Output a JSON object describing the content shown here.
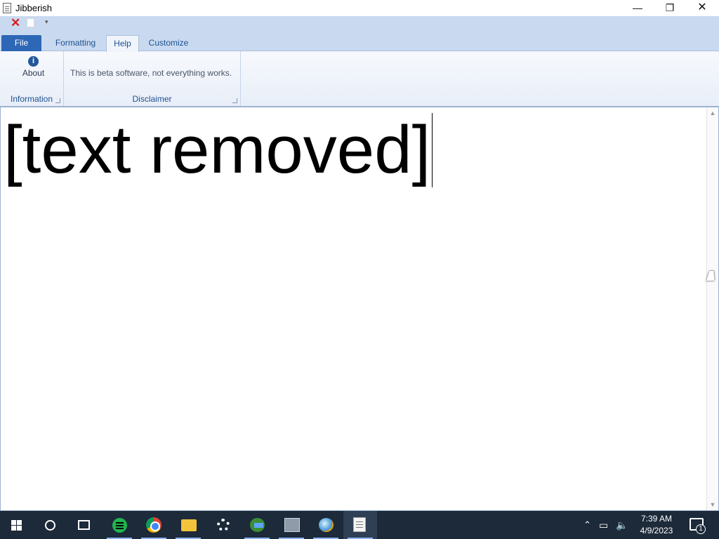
{
  "window": {
    "title": "Jibberish"
  },
  "title_controls": {
    "minimize": "—",
    "maximize": "❐",
    "close": "✕"
  },
  "quick_access": {
    "icons": [
      "close-document-icon",
      "new-document-icon",
      "customize-quick-access-icon"
    ]
  },
  "ribbon": {
    "tabs": [
      "File",
      "Formatting",
      "Help",
      "Customize"
    ],
    "active_tab": "Help",
    "groups": {
      "information": {
        "label": "Information",
        "about_label": "About"
      },
      "disclaimer": {
        "label": "Disclaimer",
        "text": "This is beta software, not everything works."
      }
    }
  },
  "editor": {
    "text": "[text removed]"
  },
  "taskbar": {
    "apps": [
      "start",
      "search",
      "task-view",
      "spotify",
      "chrome",
      "file-explorer",
      "settings",
      "internet-download-manager",
      "system-image",
      "browser",
      "jibberish"
    ],
    "active_app": "jibberish",
    "clock": {
      "time": "7:39 AM",
      "date": "4/9/2023"
    },
    "notification_count": "1"
  }
}
